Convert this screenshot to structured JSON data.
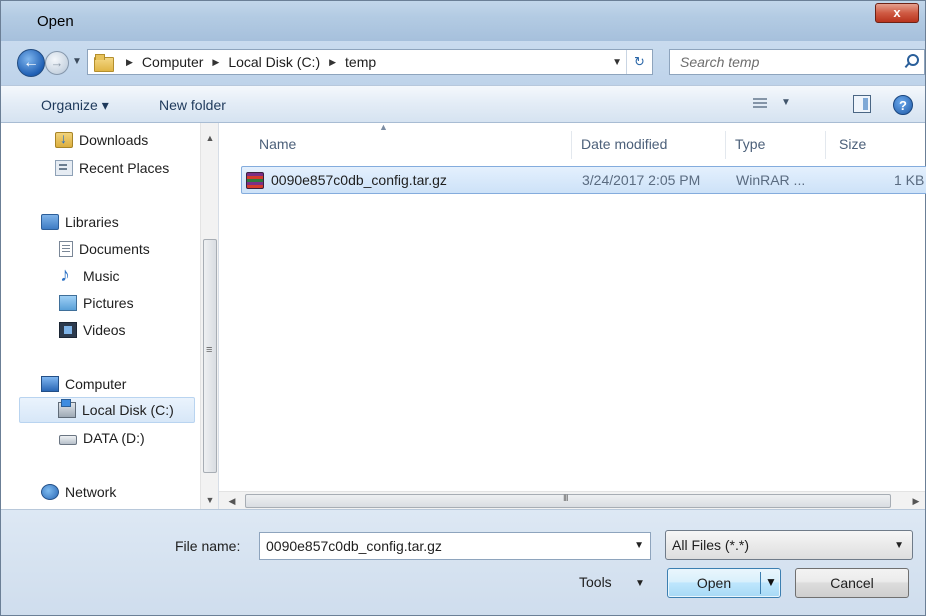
{
  "window": {
    "title": "Open",
    "close_glyph": "x"
  },
  "navigation": {
    "back_glyph": "←",
    "forward_glyph": "→",
    "breadcrumbs": [
      "Computer",
      "Local Disk (C:)",
      "temp"
    ],
    "search_placeholder": "Search temp"
  },
  "toolbar": {
    "organize": "Organize ▾",
    "new_folder": "New folder",
    "help": "?"
  },
  "sidebar": {
    "items": [
      {
        "label": "Downloads",
        "icon": "downloads-folder-icon"
      },
      {
        "label": "Recent Places",
        "icon": "recent-places-icon"
      },
      {
        "label": "Libraries",
        "icon": "libraries-icon"
      },
      {
        "label": "Documents",
        "icon": "documents-icon"
      },
      {
        "label": "Music",
        "icon": "music-icon"
      },
      {
        "label": "Pictures",
        "icon": "pictures-icon"
      },
      {
        "label": "Videos",
        "icon": "videos-icon"
      },
      {
        "label": "Computer",
        "icon": "computer-icon"
      },
      {
        "label": "Local Disk (C:)",
        "icon": "local-disk-icon",
        "selected": true
      },
      {
        "label": "DATA (D:)",
        "icon": "drive-icon"
      },
      {
        "label": "Network",
        "icon": "network-icon"
      }
    ]
  },
  "file_list": {
    "columns": {
      "name": "Name",
      "date": "Date modified",
      "type": "Type",
      "size": "Size"
    },
    "files": [
      {
        "name": "0090e857c0db_config.tar.gz",
        "date": "3/24/2017 2:05 PM",
        "type": "WinRAR ...",
        "size": "1 KB",
        "icon": "winrar-archive-icon"
      }
    ]
  },
  "footer": {
    "file_name_label": "File name:",
    "file_name_value": "0090e857c0db_config.tar.gz",
    "file_type": "All Files (*.*)",
    "tools": "Tools",
    "open": "Open",
    "cancel": "Cancel"
  }
}
